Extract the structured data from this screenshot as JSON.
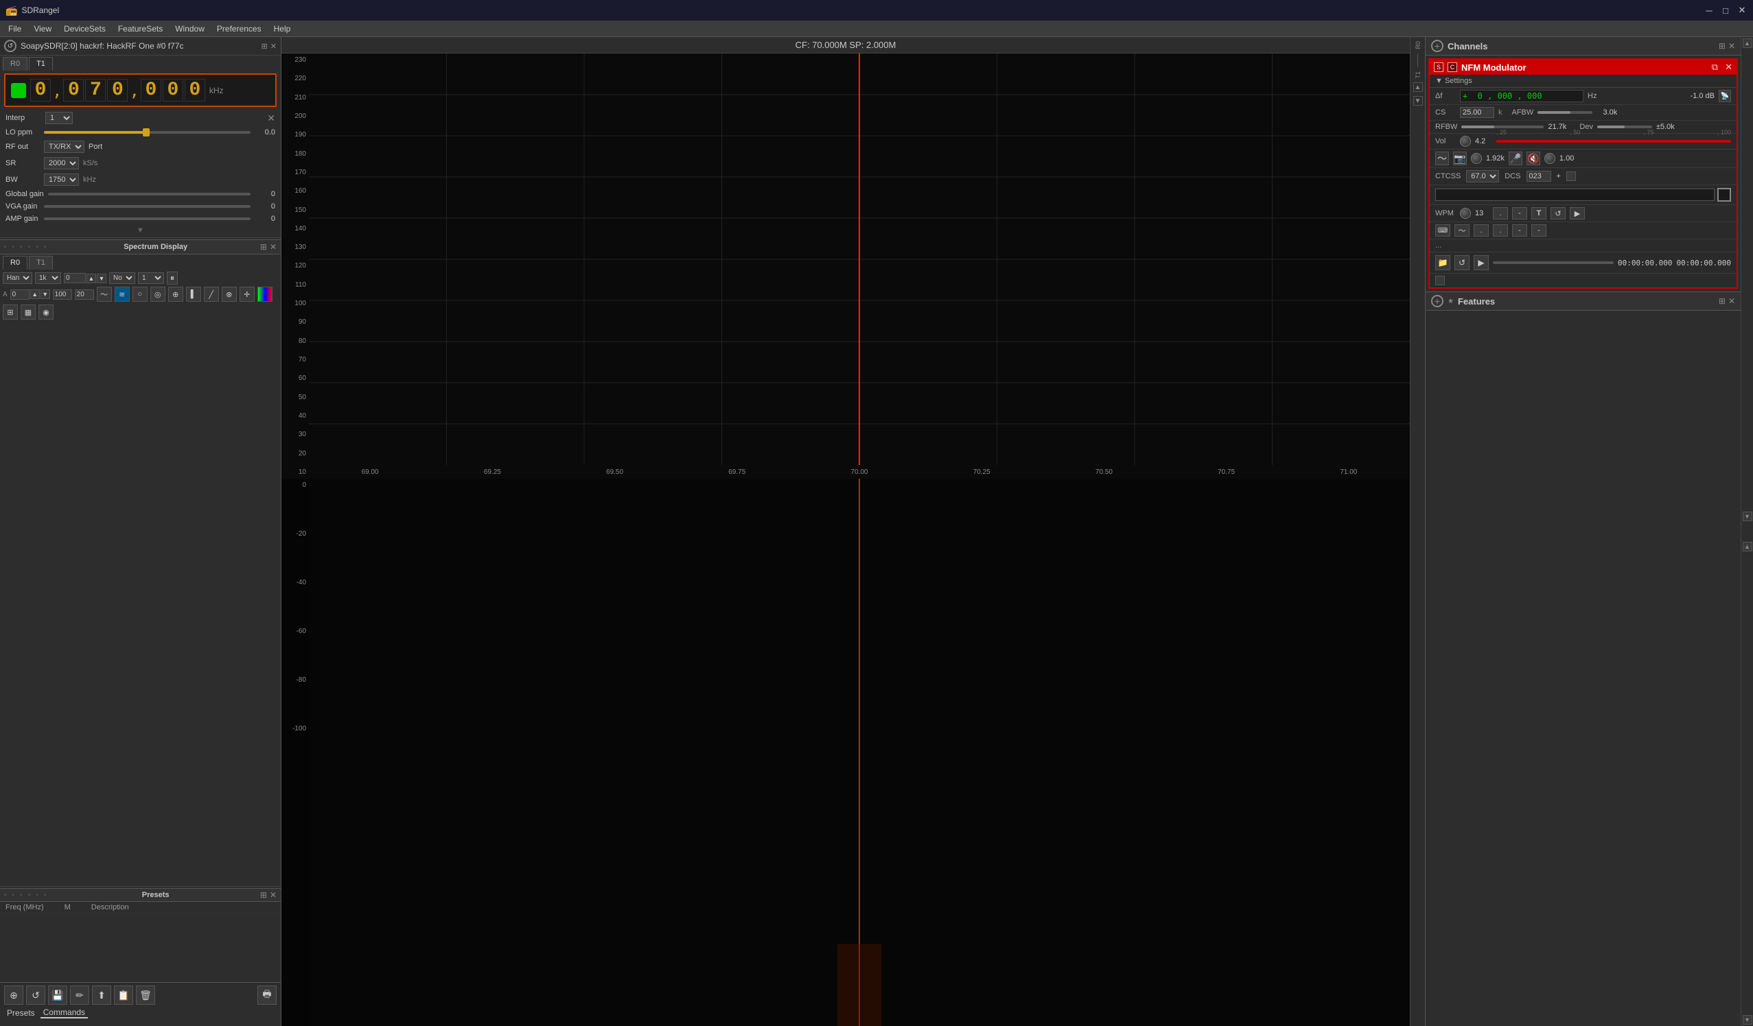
{
  "titlebar": {
    "app_name": "SDRangel",
    "min_label": "─",
    "max_label": "□",
    "close_label": "✕"
  },
  "menubar": {
    "items": [
      "File",
      "View",
      "DeviceSets",
      "FeatureSets",
      "Window",
      "Preferences",
      "Help"
    ]
  },
  "device": {
    "title": "SoapySDR[2:0] hackrf: HackRF One #0 f77c",
    "tabs": [
      "R0",
      "T1"
    ]
  },
  "frequency": {
    "value": "0,070,000",
    "digits": [
      "0",
      ",",
      "0",
      "7",
      "0",
      ",",
      "0",
      "0",
      "0"
    ],
    "unit": "kHz",
    "display": "0 , 070 , 000"
  },
  "interp": {
    "label": "Interp",
    "value": "1"
  },
  "lo_ppm": {
    "label": "LO ppm",
    "value": "0.0",
    "fill_pct": 50
  },
  "rf_out": {
    "label": "RF out",
    "options": [
      "TX/RX"
    ],
    "selected": "TX/RX",
    "port_label": "Port"
  },
  "sr": {
    "label": "SR",
    "value": "2000",
    "unit": "kS/s"
  },
  "bw": {
    "label": "BW",
    "value": "1750",
    "unit": "kHz"
  },
  "global_gain": {
    "label": "Global gain",
    "value": "0",
    "fill_pct": 0
  },
  "vga_gain": {
    "label": "VGA gain",
    "value": "0",
    "fill_pct": 0
  },
  "amp_gain": {
    "label": "AMP gain",
    "value": "0",
    "fill_pct": 0
  },
  "spectrum_display": {
    "title": "Spectrum Display",
    "tabs": [
      "R0",
      "T1"
    ],
    "window": "Han",
    "fft_size": "1k",
    "overlap": "0",
    "avg_type": "No",
    "avg_count": "1",
    "channel": "A",
    "db_value": "0",
    "db_max": "100",
    "db_step": "20",
    "icon_buttons": [
      "waveform",
      "waterfall",
      "circle",
      "circle2",
      "target",
      "bar",
      "line",
      "circle3",
      "plus",
      "grid",
      "layout",
      "circle4"
    ]
  },
  "presets": {
    "title": "Presets",
    "columns": [
      "Freq (MHz)",
      "M",
      "Description"
    ]
  },
  "bottom_toolbar": {
    "buttons": [
      "⊕",
      "↺",
      "💾",
      "✏",
      "⬆",
      "📋",
      "🗑",
      "🖶"
    ],
    "tabs": [
      "Presets",
      "Commands"
    ]
  },
  "spectrum_chart": {
    "title": "CF: 70.000M SP: 2.000M",
    "y_labels": [
      "230",
      "220",
      "210",
      "200",
      "190",
      "180",
      "170",
      "160",
      "150",
      "140",
      "130",
      "120",
      "110",
      "100",
      "90",
      "80",
      "70",
      "60",
      "50",
      "40",
      "30",
      "20",
      "10"
    ],
    "x_labels": [
      "69.00",
      "69.25",
      "69.50",
      "69.75",
      "70.00",
      "70.25",
      "70.50",
      "70.75",
      "71.00"
    ],
    "waterfall_y_labels": [
      "0",
      "-20",
      "-40",
      "-60",
      "-80",
      "-100"
    ]
  },
  "nfm": {
    "title": "NFM Modulator",
    "settings_label": "▼ Settings",
    "delta_f_label": "Δf",
    "delta_f_value": "+ 0 , 000 , 000",
    "delta_f_unit": "Hz",
    "db_value": "-1.0 dB",
    "cs_label": "CS",
    "cs_value": "25.00",
    "cs_unit": "k",
    "afbw_label": "AFBW",
    "afbw_value": "3.0k",
    "rfbw_label": "RFBW",
    "rfbw_value": "21.7k",
    "dev_label": "Dev",
    "dev_value": "±5.0k",
    "vol_label": "Vol",
    "vol_value": "4.2",
    "vol_ticks": [
      "25",
      "50",
      "75",
      "100"
    ],
    "audio_value": "1.92k",
    "audio_multiplier": "1.00",
    "ctcss_label": "CTCSS",
    "ctcss_value": "67.0",
    "dcs_label": "DCS",
    "dcs_value": "023",
    "wpm_label": "WPM",
    "wpm_value": "13",
    "morse_dot": ".",
    "morse_dash": "-",
    "dots_line": "...",
    "dot_dash_btn1": ".",
    "dot_dash_btn2": ".",
    "dash_btn1": "-",
    "dash_btn2": "-",
    "time1": "00:00:00.000",
    "time2": "00:00:00.000",
    "close_btn": "✕",
    "resize_btn": "⧉"
  },
  "channels": {
    "title": "Channels"
  },
  "features": {
    "title": "Features"
  }
}
